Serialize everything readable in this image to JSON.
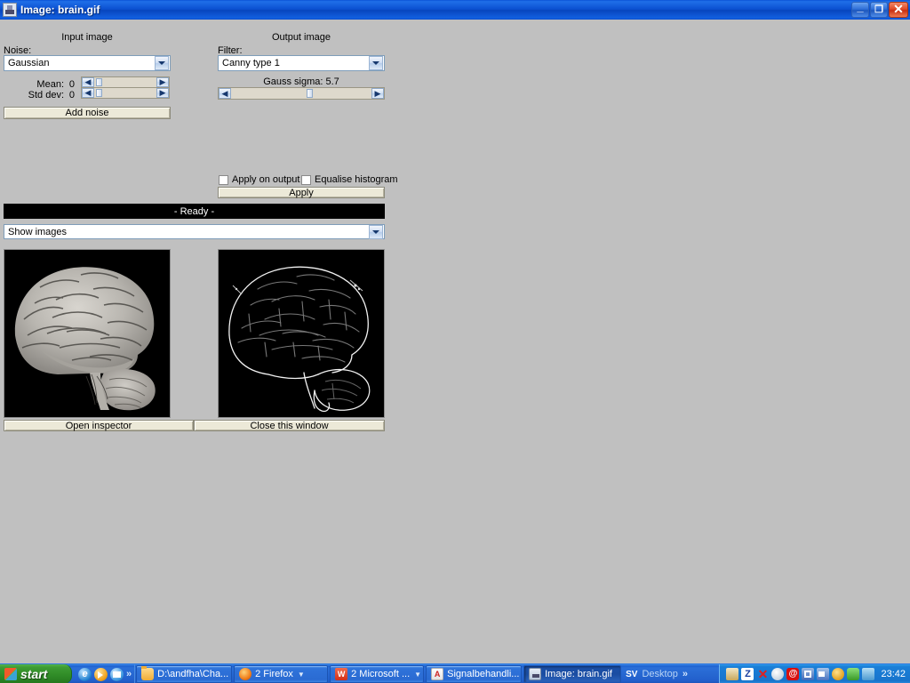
{
  "window": {
    "title": "Image: brain.gif",
    "icon": "java-coffee-icon",
    "minimize_label": "_",
    "maximize_label": "❐",
    "close_label": "✕"
  },
  "panels": {
    "input_header": "Input image",
    "output_header": "Output image"
  },
  "input": {
    "noise_label": "Noise:",
    "noise_value": "Gaussian",
    "mean_label": "Mean:",
    "mean_value": "0",
    "std_label": "Std dev:",
    "std_value": "0",
    "add_noise_label": "Add noise",
    "left_arrow": "◀",
    "right_arrow": "▶"
  },
  "output": {
    "filter_label": "Filter:",
    "filter_value": "Canny type 1",
    "sigma_label": "Gauss sigma: 5.7",
    "left_arrow": "◀",
    "right_arrow": "▶"
  },
  "actions": {
    "apply_on_output_label": "Apply on output",
    "apply_on_output_checked": false,
    "equalise_histogram_label": "Equalise histogram",
    "equalise_histogram_checked": false,
    "apply_label": "Apply"
  },
  "status": {
    "text": "- Ready -"
  },
  "show_images": {
    "value": "Show images"
  },
  "images": {
    "input_alt": "grayscale lateral photograph of a human brain",
    "output_alt": "canny edge detection outline of the brain"
  },
  "footer": {
    "open_inspector_label": "Open inspector",
    "close_window_label": "Close this window"
  },
  "taskbar": {
    "start_label": "start",
    "quicklaunch_chevron": "»",
    "buttons": [
      {
        "label": "D:\\andfha\\Cha...",
        "icon": "folder-icon",
        "dropdown": false,
        "active": false
      },
      {
        "label": "2 Firefox",
        "icon": "firefox-icon",
        "dropdown": true,
        "active": false
      },
      {
        "label": "2 Microsoft ...",
        "icon": "word-icon",
        "dropdown": true,
        "active": false
      },
      {
        "label": "Signalbehandli...",
        "icon": "pdf-icon",
        "dropdown": false,
        "active": false
      },
      {
        "label": "Image: brain.gif",
        "icon": "java-icon",
        "dropdown": false,
        "active": true
      }
    ],
    "desktop_band": {
      "sv": "SV",
      "label": "Desktop",
      "chevron": "»"
    },
    "clock": "23:42"
  },
  "colors": {
    "title_blue": "#0a4fd0",
    "panel_gray": "#c0c0c0",
    "button_face": "#ece9d8",
    "status_bg": "#000000",
    "status_fg": "#ffffff",
    "taskbar_blue": "#225fcb",
    "start_green": "#3d9c33"
  }
}
